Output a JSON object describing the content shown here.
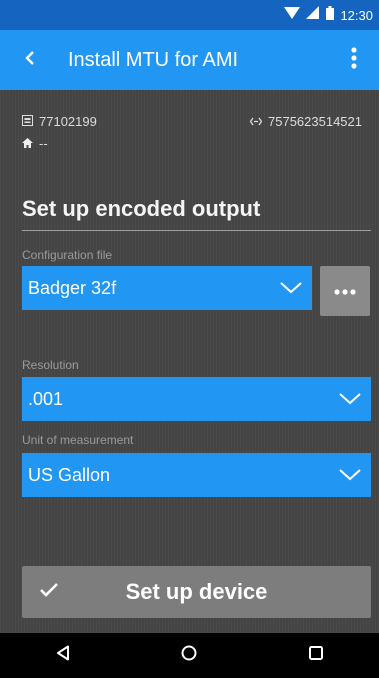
{
  "status_bar": {
    "time": "12:30",
    "icons": [
      "wifi-icon",
      "signal-icon",
      "battery-icon"
    ]
  },
  "app_bar": {
    "title": "Install MTU for AMI",
    "back_icon": "chevron-left-icon",
    "menu_icon": "overflow-menu-icon"
  },
  "device_info": {
    "meter_id": "77102199",
    "mtu_id": "7575623514521",
    "address": "--"
  },
  "section": {
    "title": "Set up encoded output"
  },
  "fields": {
    "configuration_file": {
      "label": "Configuration file",
      "value": "Badger 32f"
    },
    "resolution": {
      "label": "Resolution",
      "value": ".001"
    },
    "unit_of_measurement": {
      "label": "Unit of measurement",
      "value": "US Gallon"
    }
  },
  "more_button": {
    "icon": "more-horizontal-icon"
  },
  "primary_action": {
    "label": "Set up device",
    "icon": "check-icon"
  },
  "nav_bar": {
    "icons": [
      "back-triangle-icon",
      "home-circle-icon",
      "recents-square-icon"
    ]
  },
  "colors": {
    "status_bar": "#1565c0",
    "app_bar": "#2196f3",
    "background": "#444444",
    "select": "#2196f3",
    "button": "#7d7d7d"
  }
}
